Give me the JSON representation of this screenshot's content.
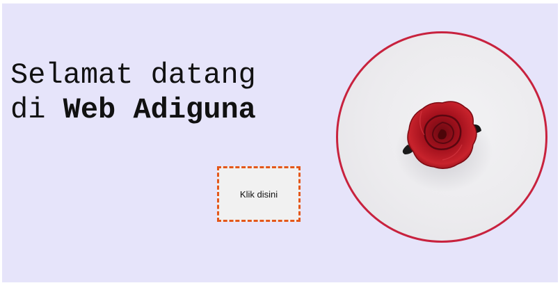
{
  "hero": {
    "headline_line1": "Selamat datang",
    "headline_line2_prefix": "di ",
    "headline_line2_bold": "Web Adiguna",
    "button_label": "Klik disini",
    "image_subject": "red-rose-photo"
  },
  "colors": {
    "page_background": "#e6e4fa",
    "button_border": "#e4571a",
    "circle_border": "#c8223e",
    "rose": "#b0101c"
  }
}
